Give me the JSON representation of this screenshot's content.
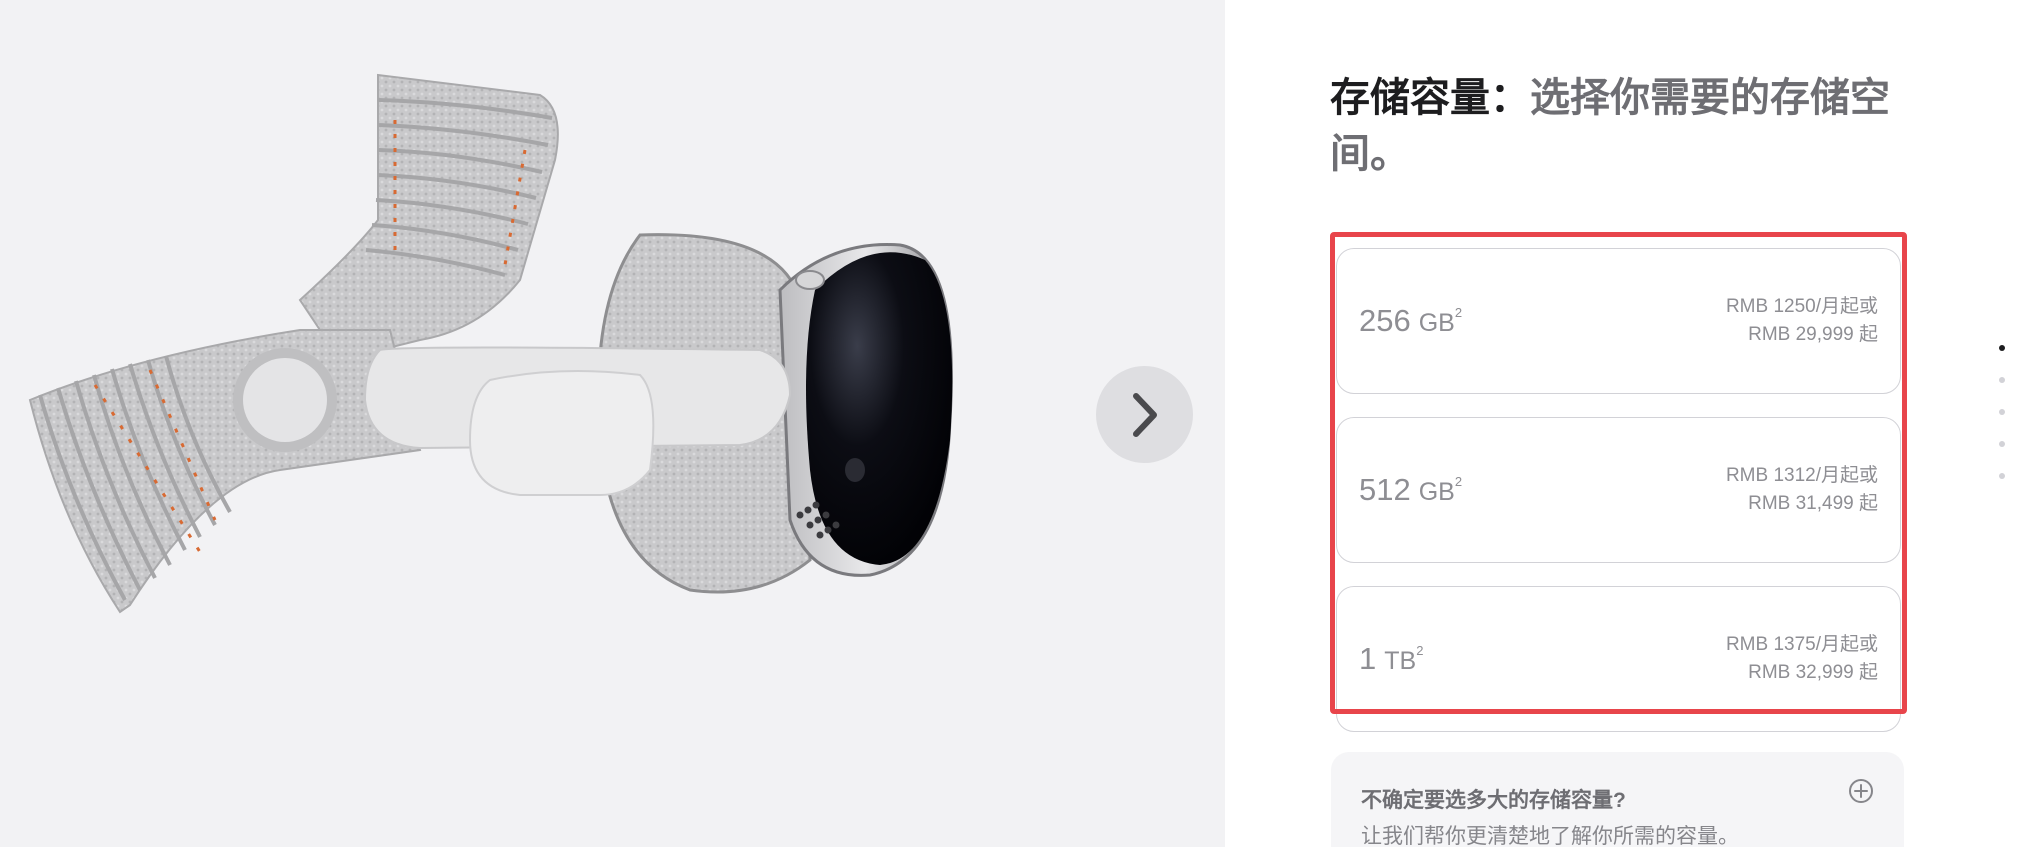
{
  "gallery": {
    "image_alt": "Apple Vision Pro headset with knit head band",
    "next_icon": "chevron-right-icon"
  },
  "heading": {
    "strong": "存储容量：",
    "muted": "选择你需要的存储空间。"
  },
  "options": [
    {
      "capacity": "256",
      "unit": "GB",
      "footnote": "2",
      "monthly": "RMB 1250/月起或",
      "price": "RMB 29,999 起"
    },
    {
      "capacity": "512",
      "unit": "GB",
      "footnote": "2",
      "monthly": "RMB 1312/月起或",
      "price": "RMB 31,499 起"
    },
    {
      "capacity": "1",
      "unit": "TB",
      "footnote": "2",
      "monthly": "RMB 1375/月起或",
      "price": "RMB 32,999 起"
    }
  ],
  "help": {
    "title": "不确定要选多大的存储容量?",
    "subtitle": "让我们帮你更清楚地了解你所需的容量。",
    "icon": "plus-circle-icon"
  },
  "pagination": {
    "count": 5,
    "active_index": 0
  },
  "colors": {
    "highlight": "#e8454b",
    "text": "#1d1d1f",
    "muted": "#6e6e73"
  }
}
